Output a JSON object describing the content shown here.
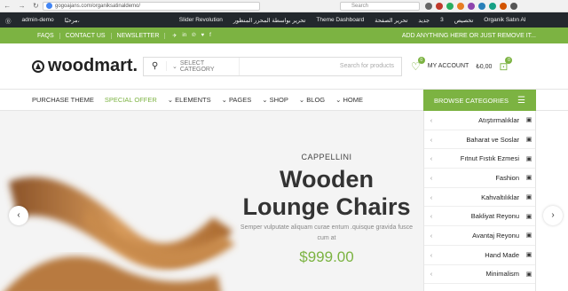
{
  "browser": {
    "url": "gogoajans.com/organiksatinaldemo/",
    "search_placeholder": "Search"
  },
  "admin_bar": {
    "items": [
      "admin-demo",
      "مرحبًا،",
      "Slider Revolution",
      "تحرير بواسطة المحرر المنظور",
      "Theme Dashboard",
      "تحرير الصفحة",
      "جديد",
      "3",
      "تخصيص",
      "Organik Satın Al"
    ]
  },
  "topbar": {
    "links": [
      "FAQS",
      "CONTACT US",
      "NEWSLETTER"
    ],
    "social": [
      "telegram",
      "linkedin",
      "pinterest",
      "twitter",
      "facebook"
    ],
    "promo": "ADD ANYTHING HERE OR JUST REMOVE IT..."
  },
  "header": {
    "logo": "woodmart.",
    "search_category": "SELECT CATEGORY",
    "search_placeholder": "Search for products",
    "account": "MY ACCOUNT",
    "cart_total": "₺0,00",
    "wishlist_count": "0",
    "compare_count": "0"
  },
  "nav": {
    "items": [
      "PURCHASE THEME",
      "SPECIAL OFFER",
      "ELEMENTS",
      "PAGES",
      "SHOP",
      "BLOG",
      "HOME"
    ],
    "active_index": 1,
    "browse_label": "BROWSE CATEGORIES"
  },
  "hero": {
    "label": "CAPPELLINI",
    "title": "Wooden Lounge Chairs",
    "subtitle": "Semper vulputate aliquam curae entum .quisque gravida fusce cum at",
    "price": "$999.00"
  },
  "categories": [
    {
      "name": "Atıştırmalıklar",
      "icon": "snack-icon"
    },
    {
      "name": "Baharat ve Soslar",
      "icon": "sauce-icon"
    },
    {
      "name": "Fıtnut Fıstık Ezmesi",
      "icon": "jar-icon"
    },
    {
      "name": "Fashion",
      "icon": "book-icon"
    },
    {
      "name": "Kahvaltılıklar",
      "icon": "book-icon"
    },
    {
      "name": "Bakliyat Reyonu",
      "icon": "book-icon"
    },
    {
      "name": "Avantaj Reyonu",
      "icon": "book-icon"
    },
    {
      "name": "Hand Made",
      "icon": "book-icon"
    },
    {
      "name": "Minimalism",
      "icon": "book-icon"
    }
  ],
  "colors": {
    "brand_green": "#7cb342",
    "admin_bar": "#23282d"
  }
}
